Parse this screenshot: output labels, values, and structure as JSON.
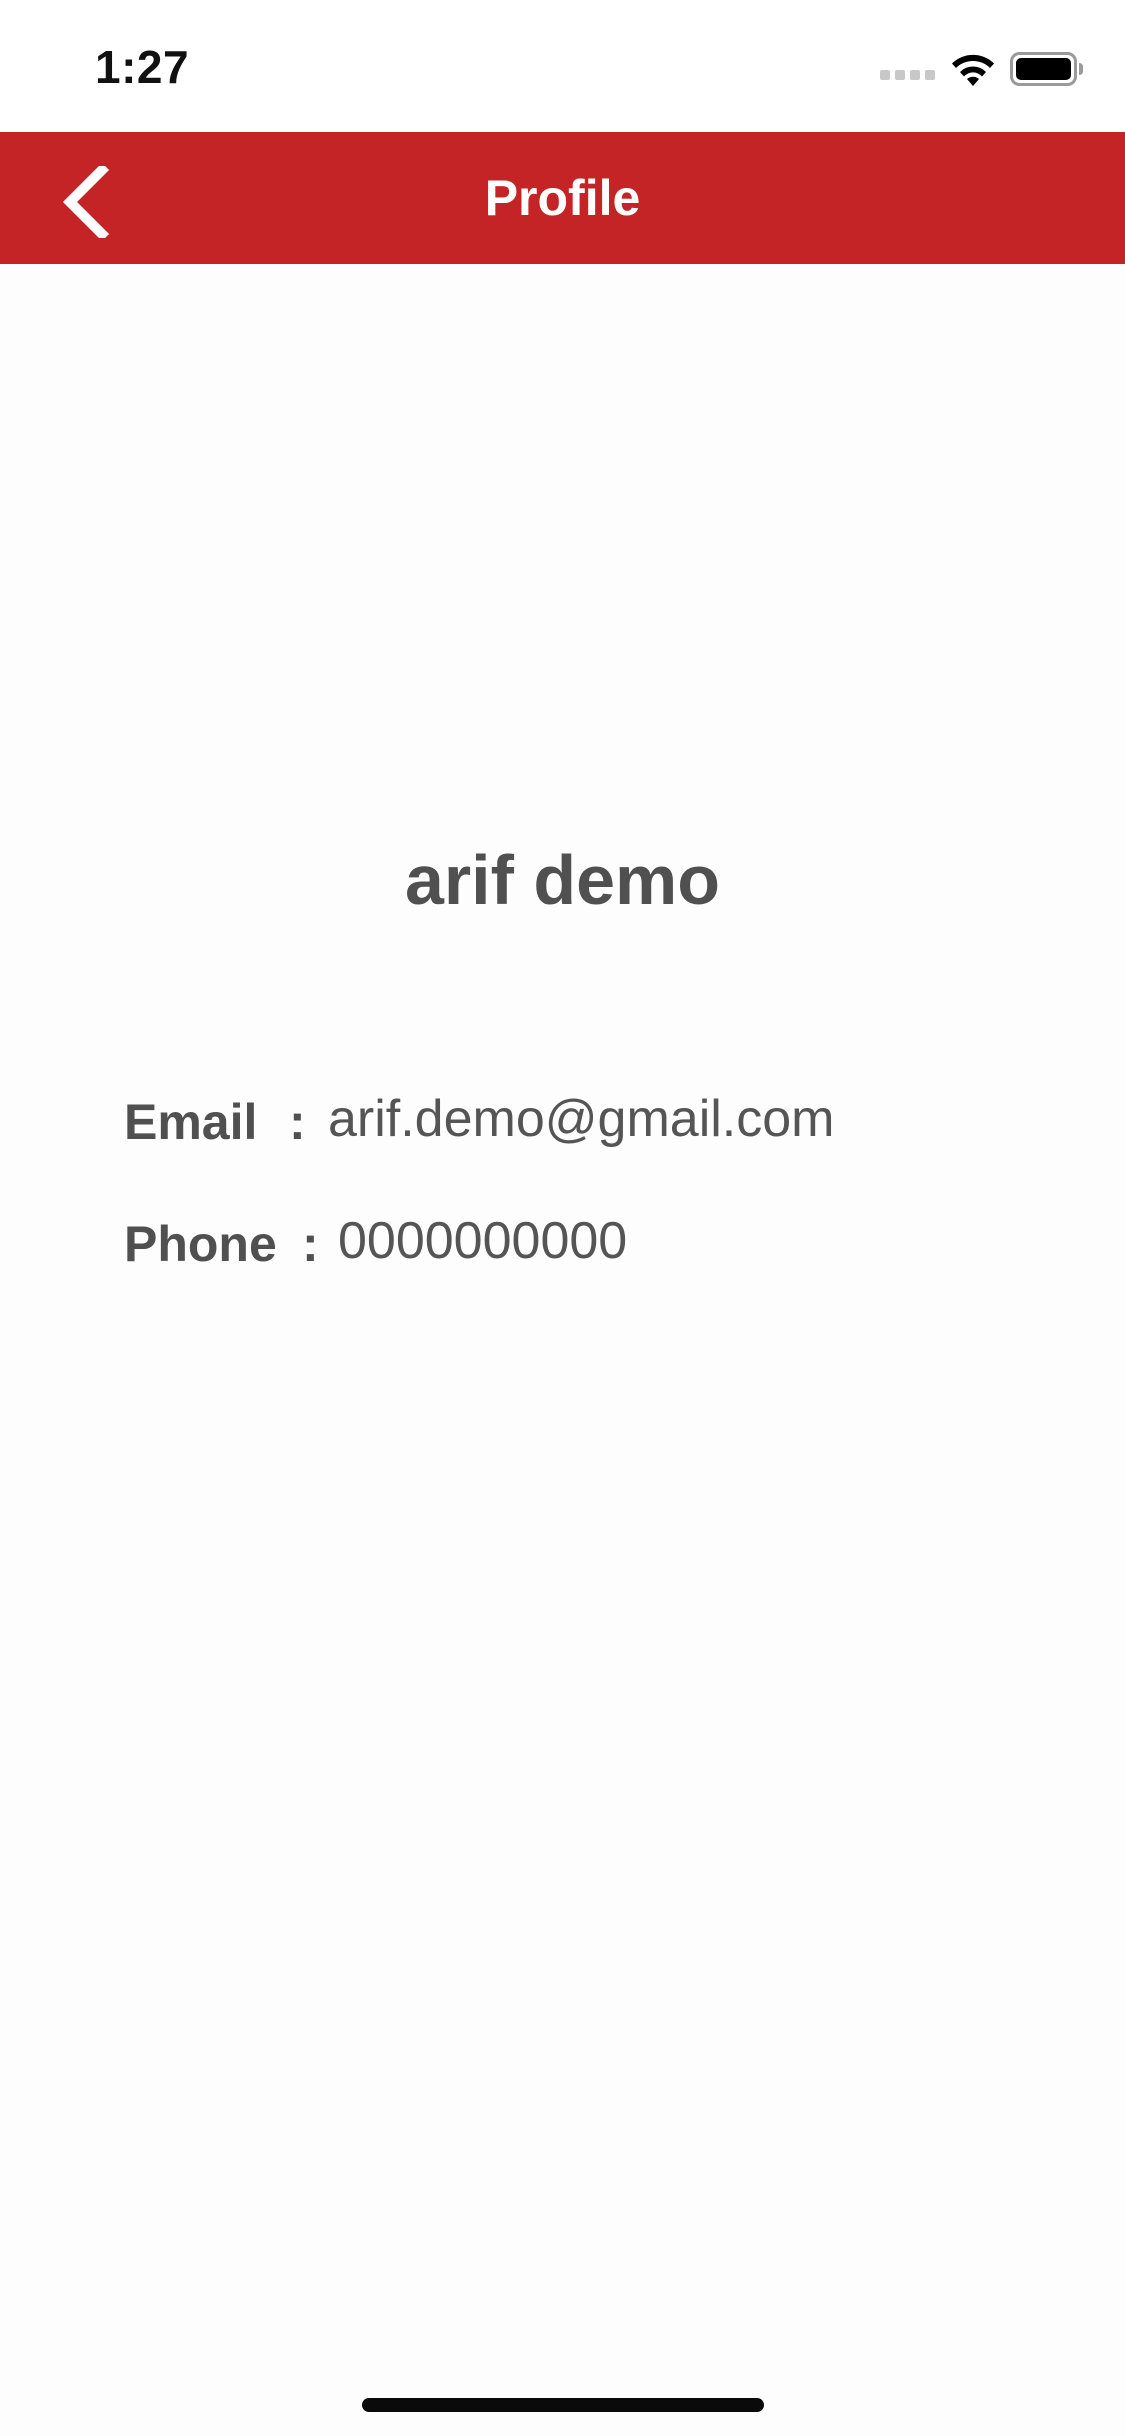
{
  "status_bar": {
    "time": "1:27",
    "icons": [
      "cellular-signal-icon",
      "wifi-icon",
      "battery-icon"
    ]
  },
  "nav": {
    "title": "Profile",
    "back_icon": "chevron-left-icon",
    "background_color": "#c42426",
    "title_color": "#ffffff"
  },
  "profile": {
    "name": "arif demo",
    "fields": {
      "email": {
        "label": "Email",
        "separator": ":",
        "value": "arif.demo@gmail.com"
      },
      "phone": {
        "label": "Phone",
        "separator": ":",
        "value": "0000000000"
      }
    }
  }
}
